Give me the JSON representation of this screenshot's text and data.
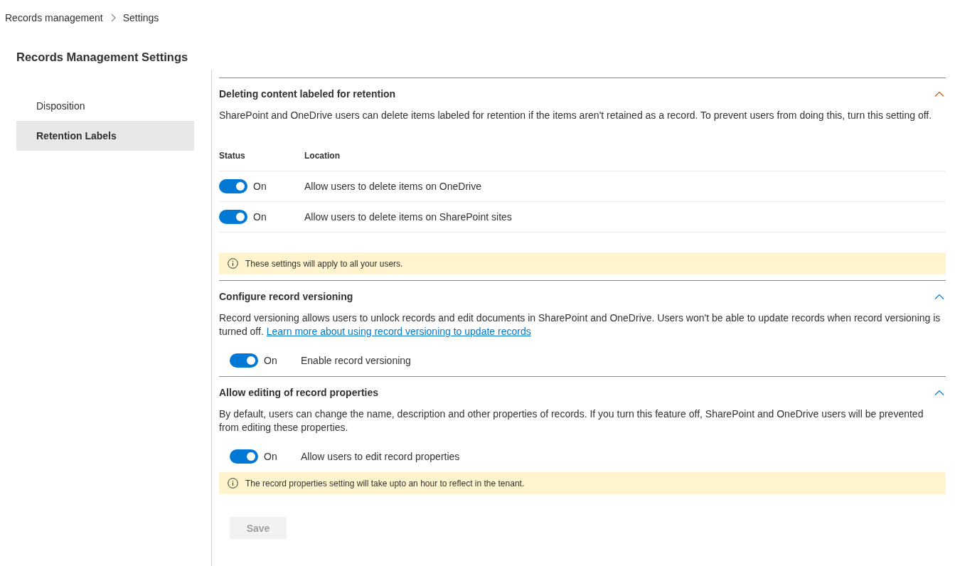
{
  "breadcrumb": [
    {
      "label": "Records management"
    },
    {
      "label": "Settings"
    }
  ],
  "page_title": "Records Management Settings",
  "sidebar": {
    "items": [
      {
        "label": "Disposition",
        "selected": false
      },
      {
        "label": "Retention Labels",
        "selected": true
      }
    ]
  },
  "sections": [
    {
      "title": "Deleting content labeled for retention",
      "expanded": true,
      "description": "SharePoint and OneDrive users can delete items labeled for retention if the items aren't retained as a record. To prevent users from doing this, turn this setting off.",
      "table": {
        "columns": [
          "Status",
          "Location"
        ],
        "rows": [
          {
            "on": true,
            "state_label": "On",
            "location": "Allow users to delete items on OneDrive"
          },
          {
            "on": true,
            "state_label": "On",
            "location": "Allow users to delete items on SharePoint sites"
          }
        ]
      },
      "notice": "These settings will apply to all your users."
    },
    {
      "title": "Configure record versioning",
      "expanded": true,
      "description": "Record versioning allows users to unlock records and edit documents in SharePoint and OneDrive. Users won't be able to update records when record versioning is turned off.",
      "link": "Learn more about using record versioning to update records",
      "toggle": {
        "on": true,
        "state_label": "On",
        "label": "Enable record versioning"
      }
    },
    {
      "title": "Allow editing of record properties",
      "expanded": true,
      "description": "By default, users can change the name, description and other properties of records. If you turn this feature off, SharePoint and OneDrive users will be prevented from editing these properties.",
      "toggle": {
        "on": true,
        "state_label": "On",
        "label": "Allow users to edit record properties"
      },
      "notice": "The record properties setting will take upto an hour to reflect in the tenant."
    }
  ],
  "save_button": {
    "label": "Save",
    "disabled": true
  }
}
